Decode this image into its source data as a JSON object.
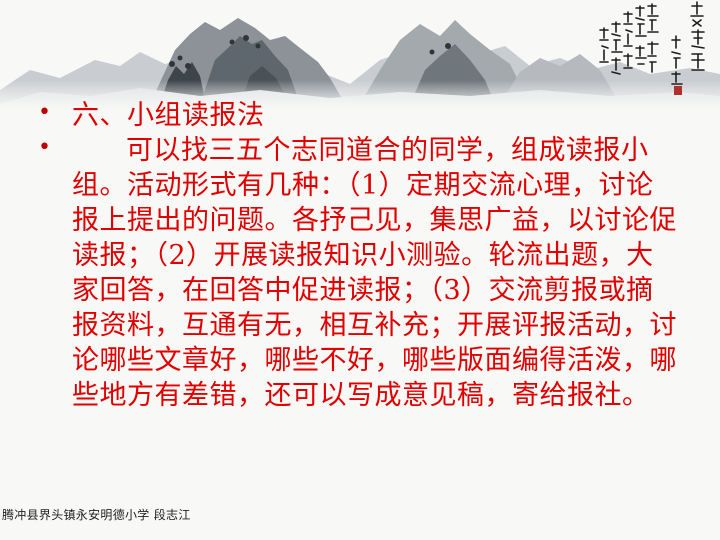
{
  "slide": {
    "heading": "六、小组读报法",
    "body": "可以找三五个志同道合的同学，组成读报小组。活动形式有几种：（1）定期交流心理，讨论报上提出的问题。各抒己见，集思广益，以讨论促读报；（2）开展读报知识小测验。轮流出题，大家回答，在回答中促进读报；（3）交流剪报或摘报资料，互通有无，相互补充；开展评报活动，讨论哪些文章好，哪些不好，哪些版面编得活泼，哪些地方有差错，还可以写成意见稿，寄给报社。",
    "bullet_symbol": "•"
  },
  "footer": {
    "text": "腾冲县界头镇永安明德小学   段志江"
  },
  "colors": {
    "text": "#e00000",
    "footer": "#222222",
    "background": "#f8f8f6"
  },
  "decor": {
    "landscape": "ink-mountain-landscape",
    "calligraphy": "vertical-calligraphy-inscription"
  }
}
